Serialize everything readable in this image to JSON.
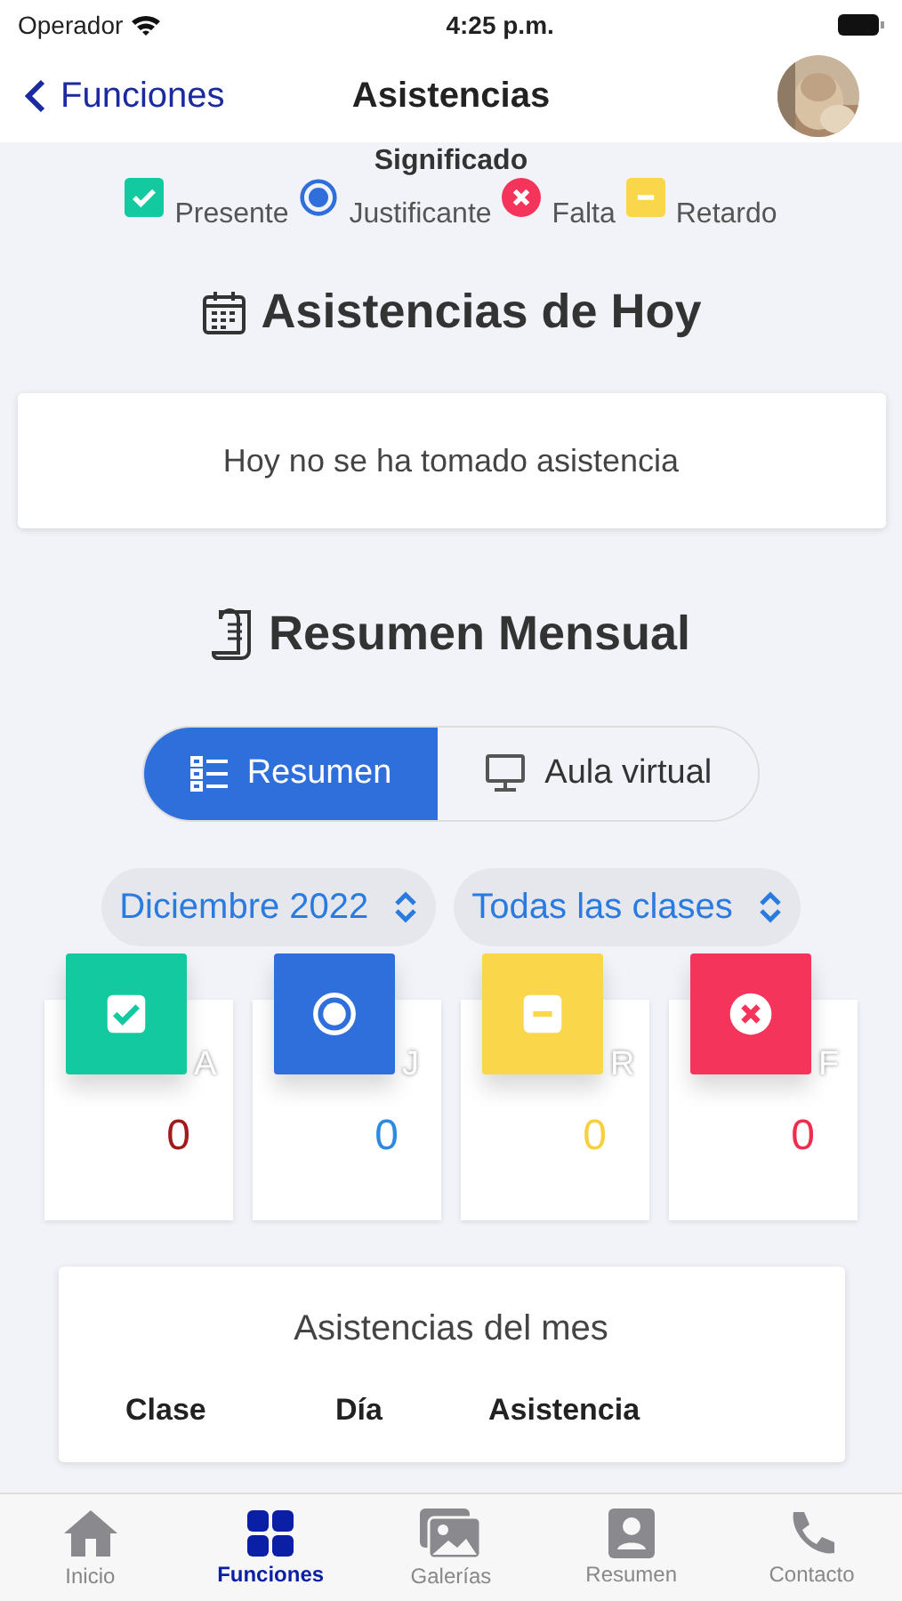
{
  "status_bar": {
    "carrier": "Operador",
    "time": "4:25 p.m."
  },
  "nav": {
    "back": "Funciones",
    "title": "Asistencias"
  },
  "legend": {
    "title": "Significado",
    "items": [
      {
        "kind": "present",
        "label": "Presente"
      },
      {
        "kind": "justified",
        "label": "Justificante"
      },
      {
        "kind": "absent",
        "label": "Falta"
      },
      {
        "kind": "late",
        "label": "Retardo"
      }
    ]
  },
  "today": {
    "heading": "Asistencias de Hoy",
    "message": "Hoy no se ha tomado asistencia"
  },
  "monthly": {
    "heading": "Resumen Mensual",
    "segments": [
      {
        "kind": "list",
        "label": "Resumen",
        "selected": true
      },
      {
        "kind": "monitor",
        "label": "Aula virtual",
        "selected": false
      }
    ],
    "pickers": [
      "Diciembre 2022",
      "Todas las clases"
    ],
    "stats": [
      {
        "kind": "present",
        "letter": "A",
        "value": "0"
      },
      {
        "kind": "justified",
        "letter": "J",
        "value": "0"
      },
      {
        "kind": "late",
        "letter": "R",
        "value": "0"
      },
      {
        "kind": "absent",
        "letter": "F",
        "value": "0"
      }
    ],
    "table": {
      "title": "Asistencias del mes",
      "columns": [
        "Clase",
        "Día",
        "Asistencia"
      ]
    }
  },
  "tab_bar": [
    {
      "kind": "home",
      "label": "Inicio",
      "selected": false
    },
    {
      "kind": "grid",
      "label": "Funciones",
      "selected": true
    },
    {
      "kind": "gallery",
      "label": "Galerías",
      "selected": false
    },
    {
      "kind": "contact-card",
      "label": "Resumen",
      "selected": false
    },
    {
      "kind": "phone",
      "label": "Contacto",
      "selected": false
    }
  ]
}
